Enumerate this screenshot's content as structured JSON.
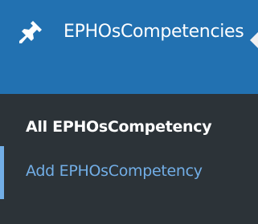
{
  "menu": {
    "title": "EPHOsCompetencies",
    "icon": "pin-icon",
    "accent_color": "#2271b1",
    "sidebar_color": "#1d2327",
    "submenu_color": "#2c3338",
    "submenu": {
      "items": [
        {
          "label": "All EPHOsCompetency",
          "current": true
        },
        {
          "label": "Add EPHOsCompetency",
          "current": false
        }
      ]
    }
  }
}
